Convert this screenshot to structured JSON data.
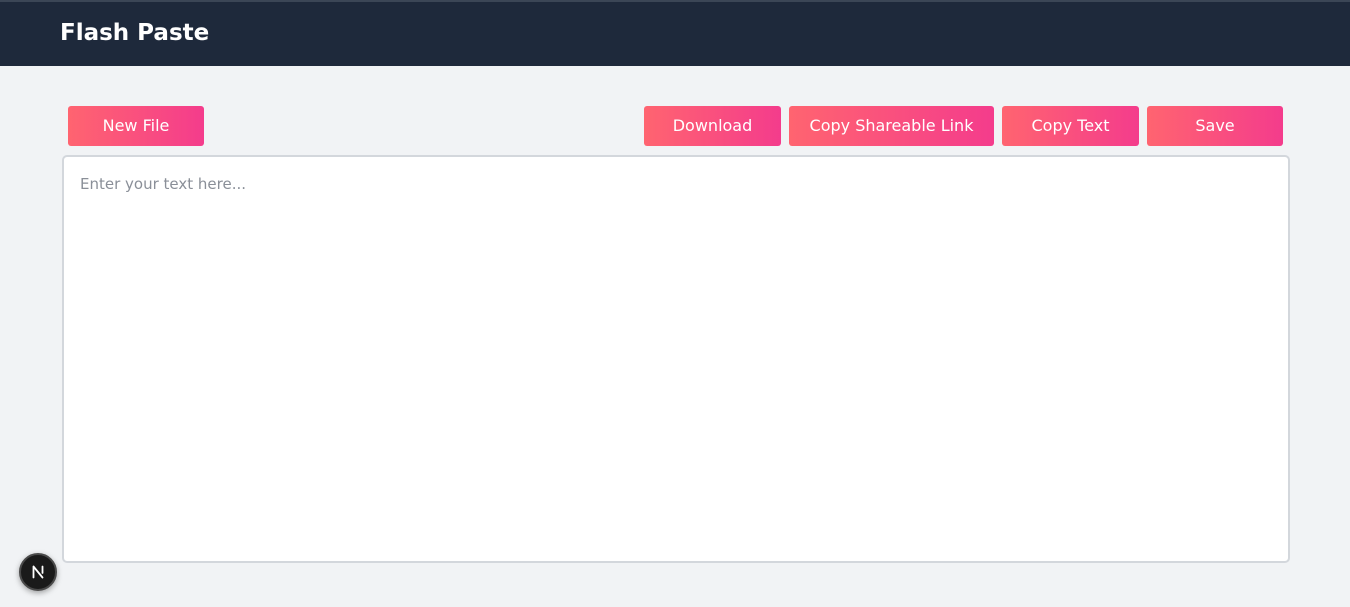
{
  "header": {
    "title": "Flash Paste"
  },
  "toolbar": {
    "new_file_label": "New File",
    "download_label": "Download",
    "copy_link_label": "Copy Shareable Link",
    "copy_text_label": "Copy Text",
    "save_label": "Save"
  },
  "editor": {
    "placeholder": "Enter your text here...",
    "value": ""
  },
  "dev_badge": {
    "icon": "next-logo-icon"
  },
  "colors": {
    "header_bg": "#1e293b",
    "page_bg": "#f1f3f5",
    "button_gradient_start": "#ff6470",
    "button_gradient_end": "#f43c8c"
  }
}
